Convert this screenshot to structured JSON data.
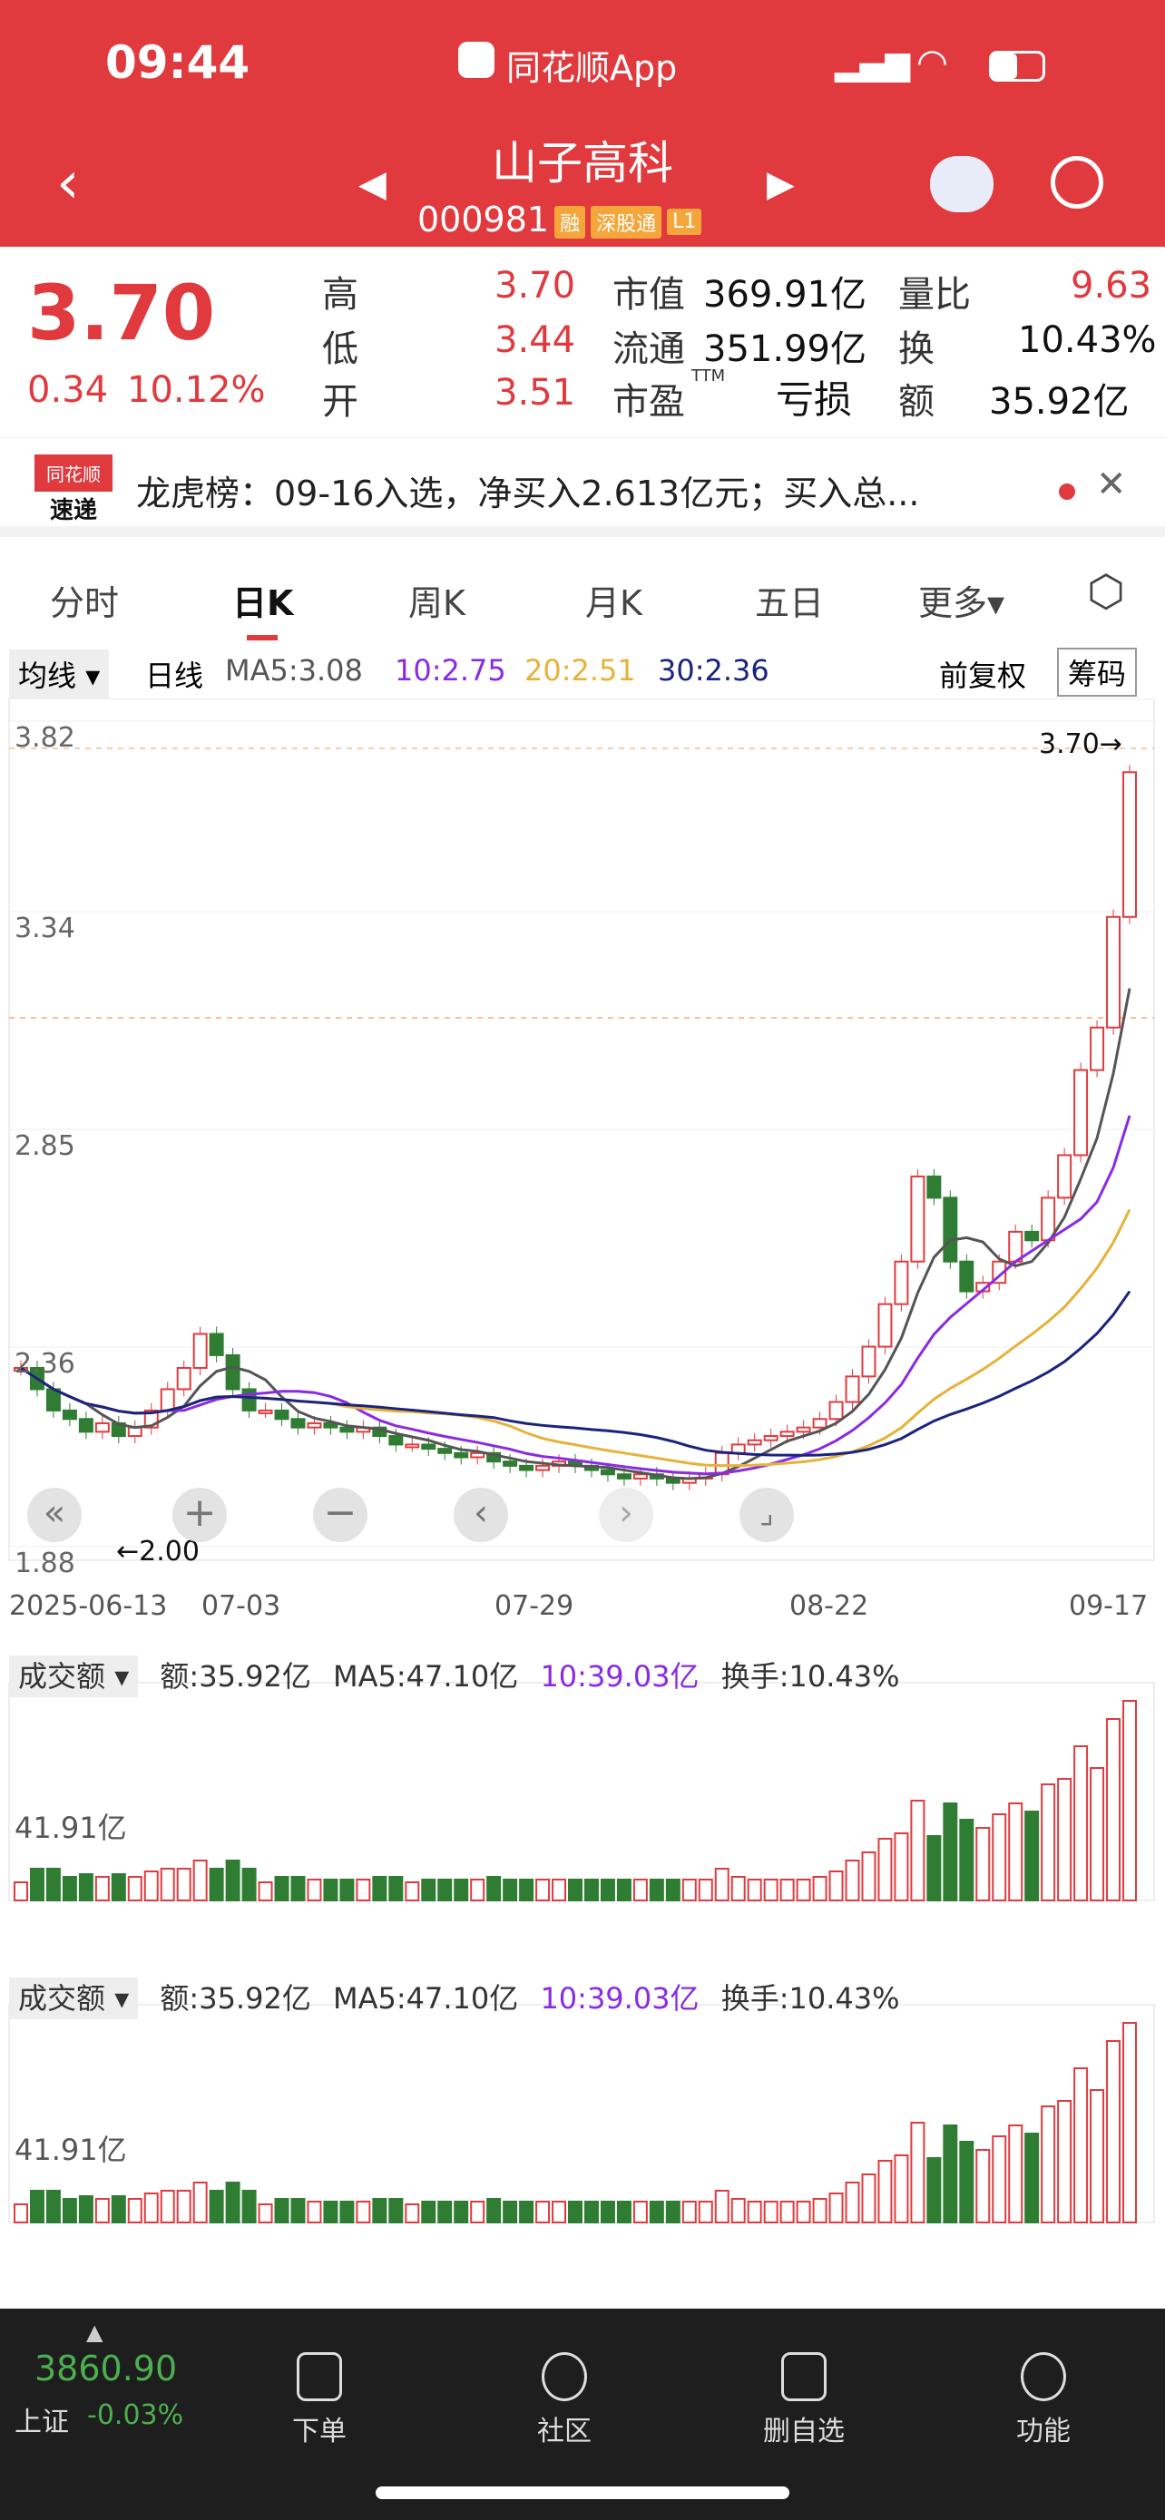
{
  "status": {
    "time": "09:44",
    "app": "同花顺App"
  },
  "header": {
    "name": "山子高科",
    "code": "000981",
    "tags": [
      "融",
      "深股通",
      "L1"
    ]
  },
  "quote": {
    "price": "3.70",
    "change": "0.34",
    "pct": "10.12%",
    "high_l": "高",
    "high": "3.70",
    "low_l": "低",
    "low": "3.44",
    "open_l": "开",
    "open": "3.51",
    "mv_l": "市值",
    "mv": "369.91亿",
    "float_l": "流通",
    "float": "351.99亿",
    "pe_l": "市盈",
    "pe_sup": "TTM",
    "pe": "亏损",
    "vr_l": "量比",
    "vr": "9.63",
    "to_l": "换",
    "to": "10.43%",
    "amt_l": "额",
    "amt": "35.92亿"
  },
  "news": {
    "badge1": "同花顺",
    "badge2": "速递",
    "text": "龙虎榜：09-16入选，净买入2.613亿元；买入总..."
  },
  "tabs": [
    "分时",
    "日K",
    "周K",
    "月K",
    "五日",
    "更多",
    "⬡"
  ],
  "ma": {
    "type": "均线",
    "period": "日线",
    "ma5": "MA5:3.08",
    "ma10": "10:2.75",
    "ma20": "20:2.51",
    "ma30": "30:2.36",
    "adj": "前复权",
    "chip": "筹码"
  },
  "chart": {
    "y_labels": [
      "3.82",
      "3.34",
      "2.85",
      "2.36",
      "1.88"
    ],
    "high_mark": "3.70→",
    "low_mark": "←2.00",
    "dates": [
      "2025-06-13",
      "07-03",
      "07-29",
      "08-22",
      "09-17"
    ]
  },
  "vol": {
    "title": "成交额",
    "amt": "额:35.92亿",
    "ma5": "MA5:47.10亿",
    "ma10": "10:39.03亿",
    "turnover": "换手:10.43%",
    "y": "41.91亿"
  },
  "bottom": {
    "index": "3860.90",
    "index_name": "上证",
    "index_pct": "-0.03%",
    "nav": [
      "下单",
      "社区",
      "删自选",
      "功能"
    ]
  },
  "colors": {
    "red": "#e03a3e",
    "green": "#2e7d32",
    "ma10": "#8a2be2",
    "ma20": "#e6b23a",
    "ma30": "#1a237e"
  }
}
